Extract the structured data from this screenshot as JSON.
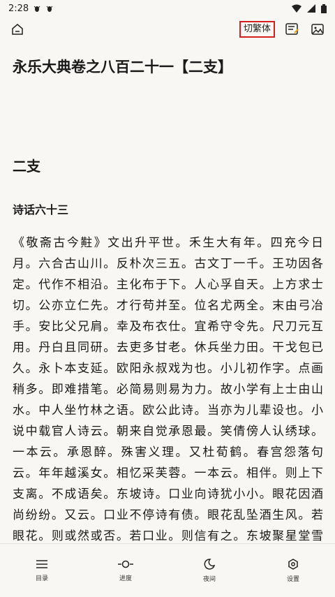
{
  "status_bar": {
    "time": "2:28"
  },
  "toolbar": {
    "home_icon": "home-icon",
    "convert_label": "切繁体",
    "notes_icon": "notes-icon",
    "image_icon": "image-icon",
    "accent_color": "#d41f1f"
  },
  "content": {
    "book_title": "永乐大典卷之八百二十一【二支】",
    "chapter_title": "二支",
    "section_title": "诗话六十三",
    "paragraph": "《敬斋古今黈》文出升平世。禾生大有年。四充今日月。六合古山川。反朴次三五。古文丁一千。王功因各定。代作不相沿。主化布于下。人心孚自天。上方求士切。公亦立仁先。才行苟并至。位名尤两全。末由弓冶手。安比父兄肩。幸及布衣仕。宜希守令先。尺刀元互用。丹白且同研。去吏多甘老。休兵坐力田。干戈包已久。永卜本支延。欧阳永叔戏为也。小儿初作字。点画稍多。即难措笔。必简易则易为力。故小学有上士由山水。中人坐竹林之语。欧公此诗。当亦为儿辈设也。小说中载官人诗云。朝来自觉承恩最。笑倩傍人认绣球。一本云。承恩醉。殊害义理。又杜荀鹤。春宫怨落句云。年年越溪女。相忆采芙蓉。一本云。相伴。则上下支离。不成语矣。东坡诗。口业向诗犹小小。眼花因酒尚纷纷。又云。口业不停诗有债。眼花乱坠酒生风。若眼花。则或然或否。若口业。则信有之。东坡聚星堂雪诗。禁体物语。而有欲浮大白追余赏。幸有回风惊落屑之句。或以谓落"
  },
  "bottom_nav": [
    {
      "label": "目录",
      "icon": "menu-icon"
    },
    {
      "label": "进度",
      "icon": "progress-icon"
    },
    {
      "label": "夜间",
      "icon": "moon-icon"
    },
    {
      "label": "设置",
      "icon": "settings-icon"
    }
  ]
}
